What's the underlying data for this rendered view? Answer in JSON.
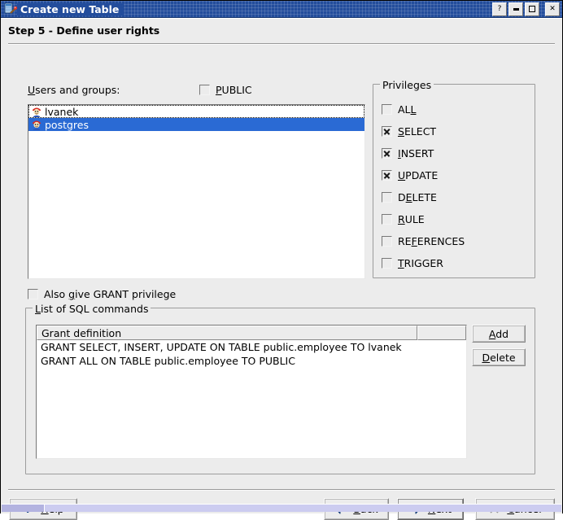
{
  "window": {
    "title": "Create new Table",
    "icon": "table-wizard-icon",
    "buttons": {
      "help": "?",
      "minimize": "minimize-icon",
      "maximize": "maximize-icon",
      "close": "✕"
    }
  },
  "step": {
    "header": "Step 5 - Define user rights"
  },
  "users": {
    "label_pre": "U",
    "label_post": "sers and groups:",
    "public_checkbox": {
      "pre": "P",
      "post": "UBLIC",
      "checked": false
    },
    "items": [
      {
        "name": "lvanek",
        "selected": false,
        "focused": true
      },
      {
        "name": "postgres",
        "selected": true,
        "focused": false
      }
    ]
  },
  "grant_option": {
    "pre": "Also ",
    "accel": "g",
    "post": "ive GRANT privilege",
    "checked": false
  },
  "privileges": {
    "legend": "Privileges",
    "items": [
      {
        "pre": "AL",
        "accel": "L",
        "post": "",
        "checked": false
      },
      {
        "pre": "",
        "accel": "S",
        "post": "ELECT",
        "checked": true
      },
      {
        "pre": "",
        "accel": "I",
        "post": "NSERT",
        "checked": true
      },
      {
        "pre": "",
        "accel": "U",
        "post": "PDATE",
        "checked": true
      },
      {
        "pre": "D",
        "accel": "E",
        "post": "LETE",
        "checked": false
      },
      {
        "pre": "",
        "accel": "R",
        "post": "ULE",
        "checked": false
      },
      {
        "pre": "RE",
        "accel": "F",
        "post": "ERENCES",
        "checked": false
      },
      {
        "pre": "",
        "accel": "T",
        "post": "RIGGER",
        "checked": false
      }
    ]
  },
  "sql": {
    "legend_pre": "L",
    "legend_post": "ist of SQL commands",
    "column_header": "Grant definition",
    "rows": [
      "GRANT SELECT, INSERT, UPDATE ON TABLE public.employee TO lvanek",
      "GRANT ALL ON TABLE public.employee TO PUBLIC"
    ],
    "add_button": {
      "pre": "",
      "accel": "A",
      "post": "dd",
      "enabled": true
    },
    "delete_button": {
      "pre": "",
      "accel": "D",
      "post": "elete",
      "enabled": false
    }
  },
  "footer": {
    "help": {
      "pre": "",
      "accel": "H",
      "post": "elp",
      "icon": "question-mark-icon"
    },
    "back": {
      "pre": "",
      "accel": "B",
      "post": "ack",
      "icon": "arrow-left-icon"
    },
    "next": {
      "pre": "",
      "accel": "N",
      "post": "ext",
      "icon": "arrow-right-icon",
      "default": true
    },
    "cancel": {
      "pre": "",
      "accel": "C",
      "post": "ancel",
      "icon": "x-mark-icon"
    }
  },
  "colors": {
    "titlebar": "#234d9c",
    "selection": "#2a6ad4",
    "face": "#ececec",
    "arrow_blue": "#1f6fd0",
    "grip": "#ccccf0"
  }
}
